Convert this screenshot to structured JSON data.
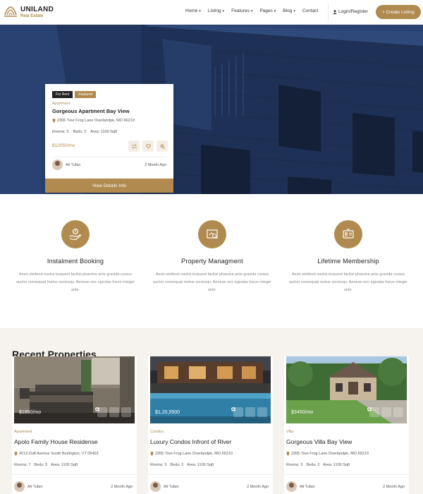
{
  "brand": {
    "name": "UNILAND",
    "tagline": "Real Estate"
  },
  "nav": {
    "items": [
      {
        "label": "Home",
        "dropdown": true
      },
      {
        "label": "Listing",
        "dropdown": true
      },
      {
        "label": "Features",
        "dropdown": true
      },
      {
        "label": "Pages",
        "dropdown": true
      },
      {
        "label": "Blog",
        "dropdown": true
      },
      {
        "label": "Contact",
        "dropdown": false
      }
    ],
    "login_label": "Login/Register",
    "create_label": "+ Create Listing"
  },
  "hero_card": {
    "badges": [
      "For Rent",
      "Featured"
    ],
    "type": "Apartment",
    "title": "Gorgeous Apartment Bay View",
    "address": "2305 Tree Frog Lane Overlandpk, MO 66210",
    "rooms": "Rooms: 5",
    "beds": "Beds: 3",
    "area": "Area: 1100 Sqft",
    "price": "$12050/mo",
    "agent": "Ali Tufan",
    "date": "2 Month Ago",
    "view_label": "View Details Info"
  },
  "features": [
    {
      "icon": "hand-money-icon",
      "title": "Instalment Booking",
      "desc": "Amet eleifend nostra torquent facilisi pharetra ante gravida cursus auctor consequat metus sociosqu. Aenean nec egestas fusce integer ante."
    },
    {
      "icon": "property-search-icon",
      "title": "Property Managment",
      "desc": "Amet eleifend nostra torquent facilisi pharetra ante gravida cursus auctor consequat metus sociosqu. Aenean nec egestas fusce integer ante."
    },
    {
      "icon": "membership-card-icon",
      "title": "Lifetime Membership",
      "desc": "Amet eleifend nostra torquent facilisi pharetra ante gravida cursus auctor consequat metus sociosqu. Aenean nec egestas fusce integer ante."
    }
  ],
  "recent": {
    "title": "Recent Properties",
    "cards": [
      {
        "price": "$1850/mo",
        "type": "Apartment",
        "title": "Apolo Family House Residense",
        "address": "4213 Duff Avenue South Burlington, VT 05403",
        "rooms": "Rooms: 7",
        "beds": "Beds: 5",
        "area": "Area: 1100 Sqft",
        "agent": "Ali Tufan",
        "date": "2 Month Ago"
      },
      {
        "price": "$1,20,5500",
        "type": "Condos",
        "title": "Luxury Condos Infront of River",
        "address": "2305 Tree Frog Lane Overlandpk, MO 66210",
        "rooms": "Rooms: 5",
        "beds": "Beds: 3",
        "area": "Area: 1100 Sqft",
        "agent": "Ali Tufan",
        "date": "2 Month Ago"
      },
      {
        "price": "$3450/mo",
        "type": "Villa",
        "title": "Gorgeous Villa Bay View",
        "address": "2305 Tree Frog Lane Overlandpk, MO 66210",
        "rooms": "Rooms: 5",
        "beds": "Beds: 3",
        "area": "Area: 1100 Sqft",
        "agent": "Ali Tufan",
        "date": "2 Month Ago"
      }
    ]
  },
  "colors": {
    "accent": "#b08a4f",
    "hero_overlay": "#24385e",
    "section_bg": "#f6f3ee"
  }
}
